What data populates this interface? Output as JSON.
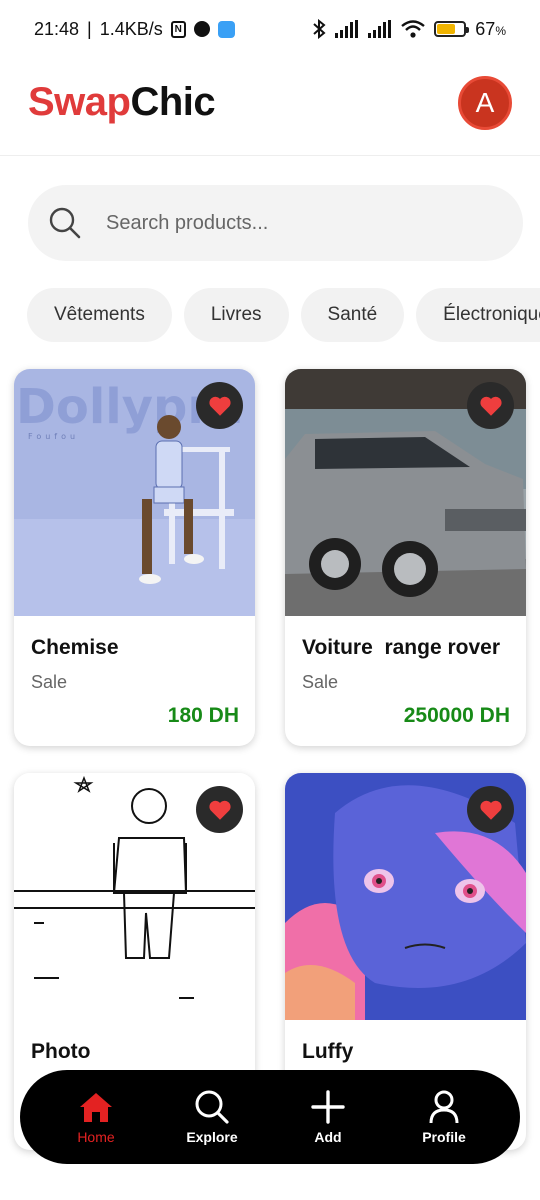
{
  "status_bar": {
    "time": "21:48",
    "network_speed": "1.4KB/s",
    "battery_percent": "67",
    "battery_level": 0.67
  },
  "header": {
    "logo_part1": "Swap",
    "logo_part2": "Chic",
    "avatar_initial": "A"
  },
  "search": {
    "placeholder": "Search products..."
  },
  "categories": [
    "Vêtements",
    "Livres",
    "Santé",
    "Électronique"
  ],
  "products": [
    {
      "title": "Chemise",
      "type": "Sale",
      "price": "180 DH"
    },
    {
      "title": "Voiture  range rover",
      "type": "Sale",
      "price": "250000 DH"
    },
    {
      "title": "Photo",
      "type": "",
      "price": ""
    },
    {
      "title": "Luffy",
      "type": "",
      "price": ""
    }
  ],
  "images": {
    "chemise_banner": "Dollypra",
    "chemise_subtitle": "Foufou"
  },
  "bottom_nav": [
    {
      "label": "Home",
      "icon": "home-icon"
    },
    {
      "label": "Explore",
      "icon": "search-icon"
    },
    {
      "label": "Add",
      "icon": "plus-icon"
    },
    {
      "label": "Profile",
      "icon": "user-icon"
    }
  ],
  "colors": {
    "brand_red": "#e03b3b",
    "price_green": "#178a17",
    "nav_active": "#e32222",
    "avatar_bg": "#c9341f"
  }
}
